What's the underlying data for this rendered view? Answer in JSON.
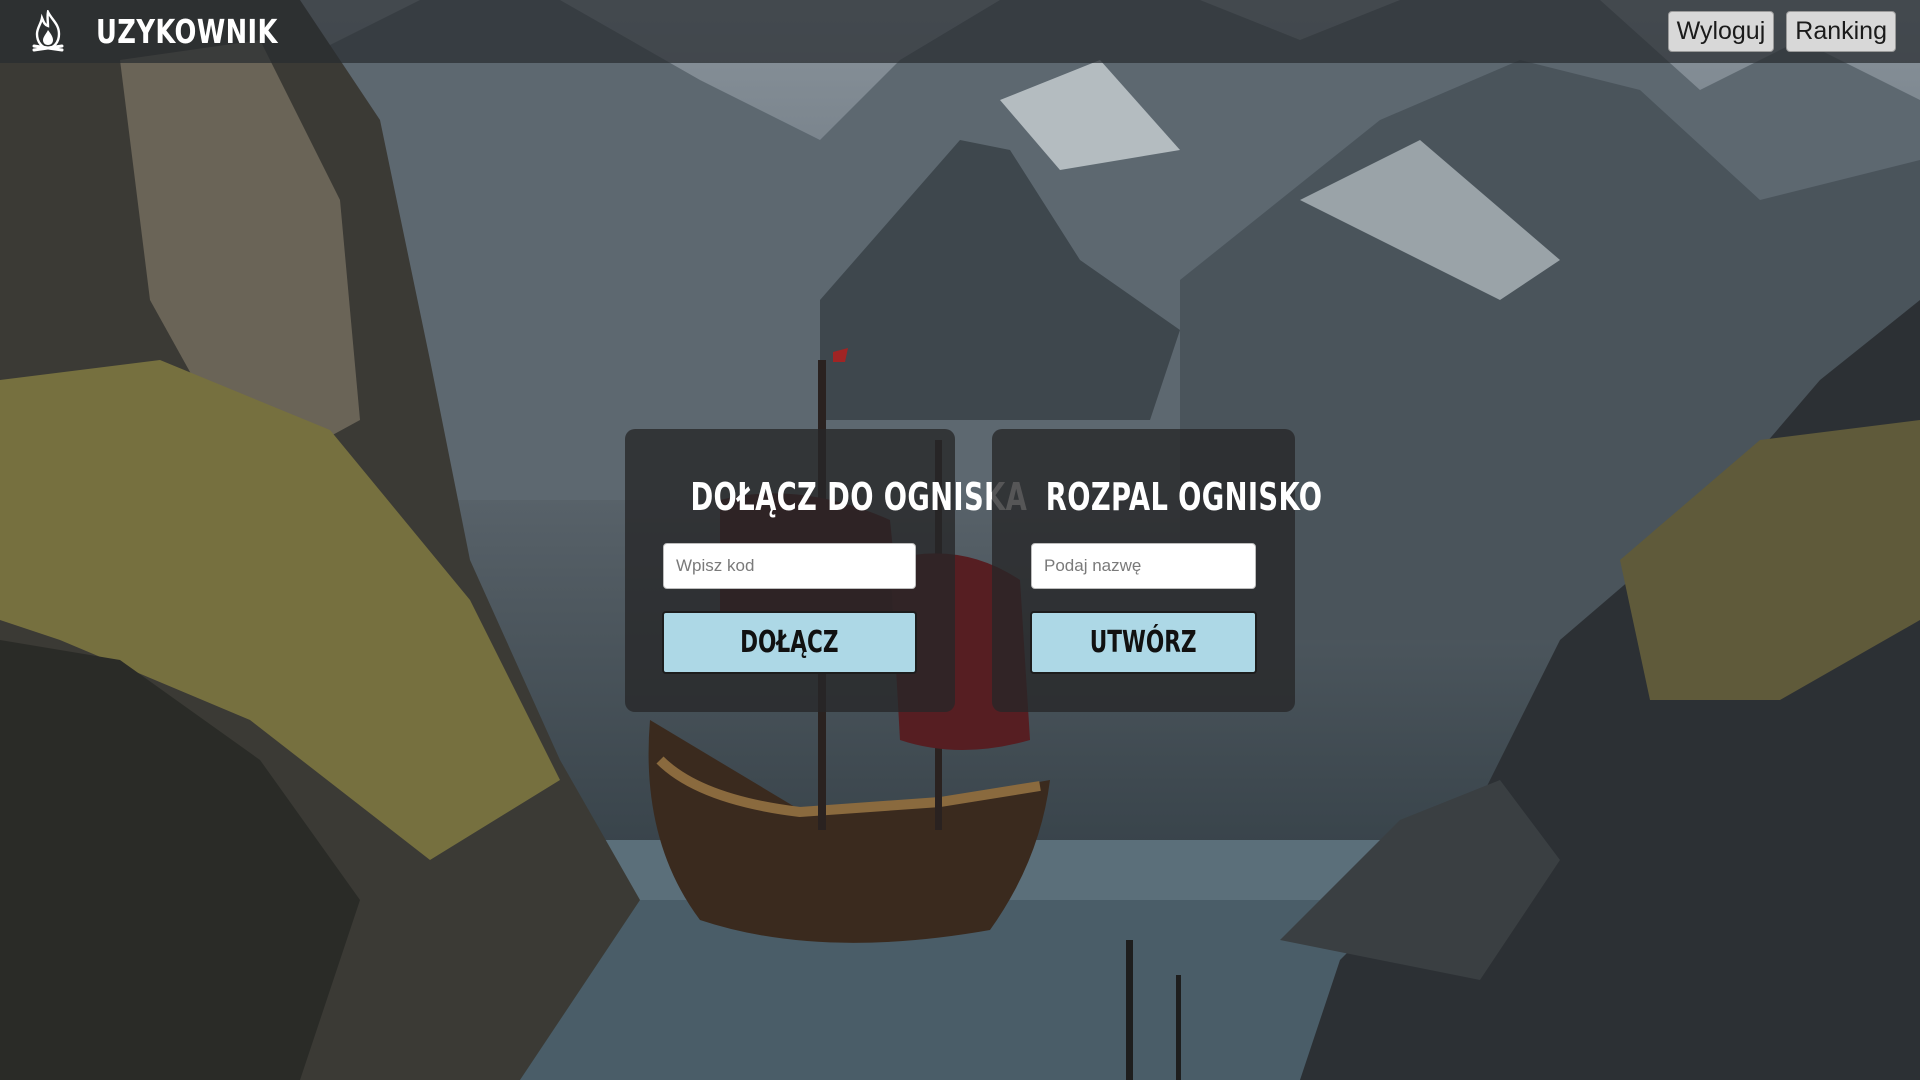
{
  "header": {
    "logo_icon": "campfire-icon",
    "username": "UZYKOWNIK",
    "logout_label": "Wyloguj",
    "ranking_label": "Ranking"
  },
  "join_panel": {
    "title": "DOŁĄCZ DO OGNISKA",
    "code_placeholder": "Wpisz kod",
    "join_label": "DOŁĄCZ"
  },
  "create_panel": {
    "title": "ROZPAL OGNISKO",
    "name_placeholder": "Podaj nazwę",
    "create_label": "UTWÓRZ"
  },
  "colors": {
    "topbar": "#282c30",
    "panel": "#262628",
    "action_button": "#add8e6",
    "nav_button": "#d8d8d8"
  }
}
